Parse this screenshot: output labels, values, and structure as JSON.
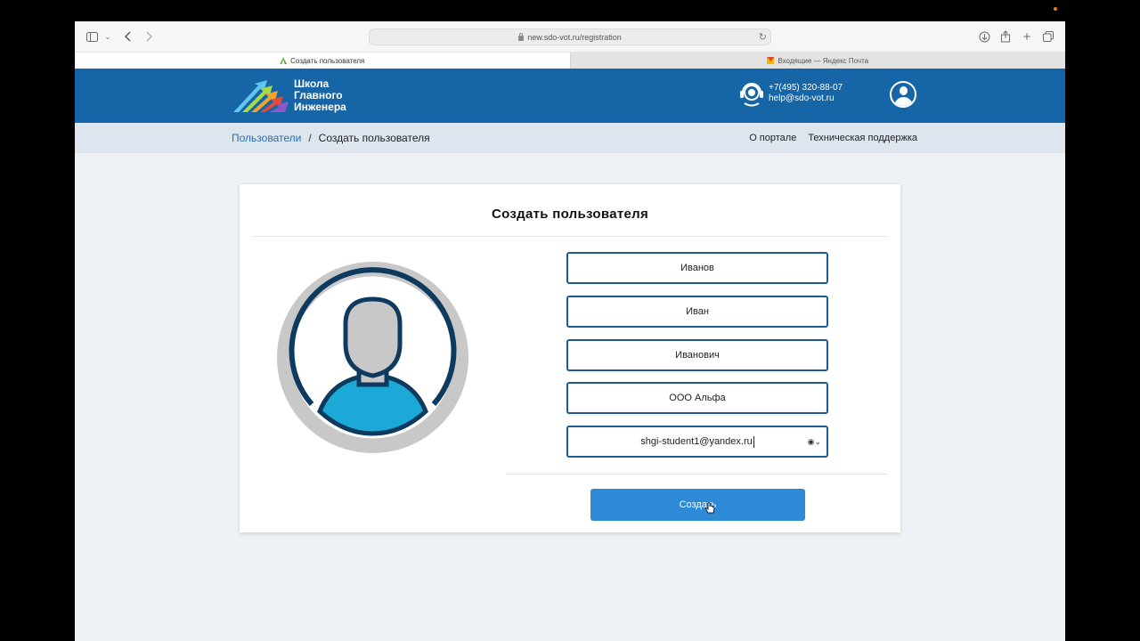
{
  "browser": {
    "url": "new.sdo-vot.ru/registration",
    "tabs": [
      {
        "label": "Создать пользователя",
        "active": true
      },
      {
        "label": "Входящие — Яндекс Почта",
        "active": false
      }
    ]
  },
  "header": {
    "logo_line1": "Школа",
    "logo_line2": "Главного",
    "logo_line3": "Инженера",
    "phone": "+7(495) 320-88-07",
    "email": "help@sdo-vot.ru"
  },
  "breadcrumb": {
    "parent": "Пользователи",
    "separator": "/",
    "current": "Создать пользователя"
  },
  "topnav": {
    "about": "О портале",
    "support": "Техническая поддержка"
  },
  "form": {
    "title": "Создать пользователя",
    "last_name": "Иванов",
    "first_name": "Иван",
    "middle_name": "Иванович",
    "company": "ООО Альфа",
    "email": "shgi-student1@yandex.ru",
    "submit_label": "Создать"
  },
  "colors": {
    "header_bg": "#1565a7",
    "breadcrumb_bg": "#dde6ef",
    "button_bg": "#2e8ad6",
    "field_border": "#1a5a96",
    "avatar_accent": "#1da9d8"
  }
}
